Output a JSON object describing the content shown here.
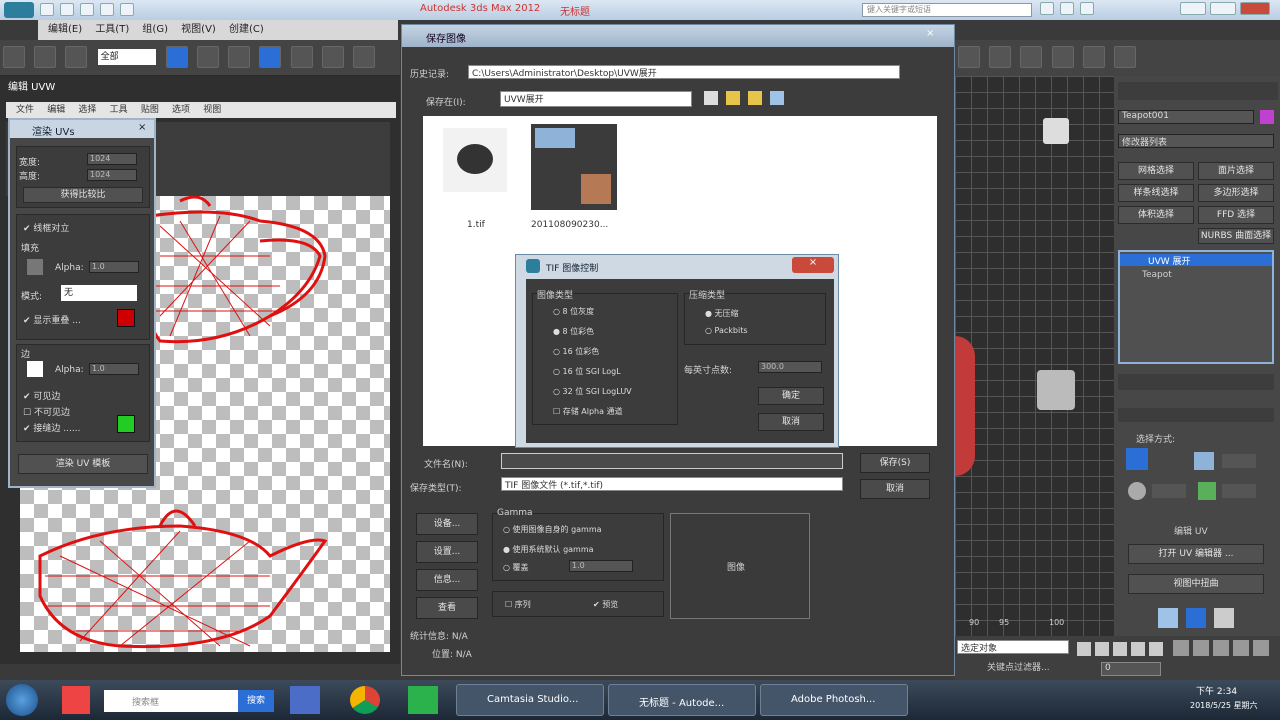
{
  "app": {
    "title": "Autodesk 3ds Max 2012",
    "doc": "无标题",
    "search_placeholder": "键入关键字或短语"
  },
  "menubar": {
    "items": [
      "编辑(E)",
      "工具(T)",
      "组(G)",
      "视图(V)",
      "创建(C)"
    ]
  },
  "toolbar": {
    "selection_filter": "全部"
  },
  "left_window": {
    "title": "编辑 UVW",
    "menu": [
      "文件",
      "编辑",
      "选择",
      "工具",
      "贴图",
      "选项",
      "视图"
    ]
  },
  "render_uvw": {
    "title": "渲染 UVs",
    "width_label": "宽度:",
    "width": "1024",
    "height_label": "高度:",
    "height": "1024",
    "uv_ratio_button": "获得比较比",
    "edge_alpha_check": "线框对立",
    "fill_section": "填充",
    "alpha_label": "Alpha:",
    "alpha_val": "1.0",
    "mode_label": "模式:",
    "mode_val": "无",
    "show_seam": "显示重叠 ...",
    "edge_section": "边",
    "alpha_label2": "Alpha:",
    "alpha_val2": "1.0",
    "visible_edges": "可见边",
    "invisible_edges": "不可见边",
    "seam_edges": "接缝边 ......",
    "render_button": "渲染 UV 模板"
  },
  "save_dialog": {
    "title": "保存图像",
    "history_label": "历史记录:",
    "history_path": "C:\\Users\\Administrator\\Desktop\\UVW展开",
    "savein_label": "保存在(I):",
    "savein_val": "UVW展开",
    "files": [
      {
        "name": "1.tif"
      },
      {
        "name": "201108090230..."
      }
    ],
    "filename_label": "文件名(N):",
    "filename_val": "",
    "filetype_label": "保存类型(T):",
    "filetype_val": "TIF 图像文件 (*.tif,*.tif)",
    "save_button": "保存(S)",
    "cancel_button": "取消",
    "devices_button": "设备...",
    "setup_button": "设置...",
    "info_button": "信息...",
    "view_button": "查看",
    "gamma_label": "Gamma",
    "gamma_opt1": "使用图像自身的 gamma",
    "gamma_opt2": "使用系统默认 gamma",
    "gamma_opt3": "覆盖",
    "gamma_val": "1.0",
    "sequence_check": "序列",
    "preview_check": "预览",
    "preview_label": "图像",
    "stats_label": "统计信息: N/A",
    "location_label": "位置: N/A"
  },
  "tif_dialog": {
    "title": "TIF 图像控制",
    "image_type_label": "图像类型",
    "types": [
      "8 位灰度",
      "8 位彩色",
      "16 位彩色",
      "16 位 SGI LogL",
      "32 位 SGI LogLUV"
    ],
    "store_alpha": "存储 Alpha 通道",
    "compress_label": "压缩类型",
    "compress_opts": [
      "无压缩",
      "Packbits"
    ],
    "dpi_label": "每英寸点数:",
    "dpi_val": "300.0",
    "ok_button": "确定",
    "cancel_button": "取消"
  },
  "right_panel": {
    "object_name": "Teapot001",
    "modifier_list": "修改器列表",
    "buttons": [
      "网格选择",
      "面片选择",
      "样条线选择",
      "多边形选择",
      "体积选择",
      "FFD 选择",
      "NURBS 曲面选择"
    ],
    "stack": [
      "UVW 展开",
      "Teapot"
    ],
    "selection_label": "选择方式:",
    "edit_uv_label": "编辑 UV",
    "open_editor": "打开 UV 编辑器 ...",
    "view_align": "视图中扭曲"
  },
  "bottom": {
    "select_label": "选定对象",
    "keyfilter": "关键点过滤器...",
    "frame": "0",
    "ruler": [
      "90",
      "95",
      "100"
    ]
  },
  "taskbar": {
    "search": "搜索框",
    "search_btn": "搜索",
    "items": [
      "Camtasia Studio...",
      "无标题 - Autode...",
      "Adobe Photosh..."
    ],
    "time": "下午 2:34",
    "date": "2018/5/25 星期六"
  },
  "colors": {
    "accent": "#cc0000",
    "green": "#22cc22",
    "selection": "#2b6fd6"
  }
}
